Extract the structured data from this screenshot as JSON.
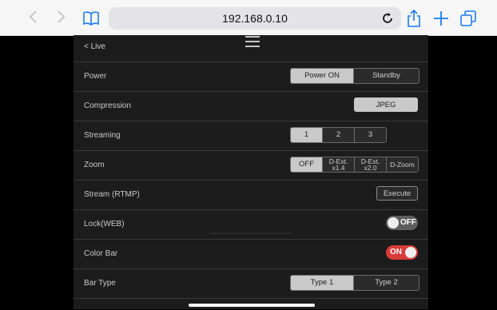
{
  "browser": {
    "url": "192.168.0.10",
    "icons": [
      "chevron-left-icon",
      "chevron-right-icon",
      "bookmarks-icon",
      "reload-icon",
      "share-icon",
      "plus-icon",
      "tabs-icon"
    ]
  },
  "page": {
    "back_label": "< Live",
    "menu_icon": "hamburger-menu-icon"
  },
  "settings": {
    "power": {
      "label": "Power",
      "options": [
        "Power ON",
        "Standby"
      ],
      "selected": "Power ON"
    },
    "compression": {
      "label": "Compression",
      "button": "JPEG"
    },
    "streaming": {
      "label": "Streaming",
      "options": [
        "1",
        "2",
        "3"
      ],
      "selected": "1"
    },
    "zoom": {
      "label": "Zoom",
      "options": [
        {
          "line1": "OFF",
          "line2": ""
        },
        {
          "line1": "D-Ext.",
          "line2": "x1.4"
        },
        {
          "line1": "D-Ext.",
          "line2": "x2.0"
        },
        {
          "line1": "D-Zoom",
          "line2": ""
        }
      ],
      "selected": "OFF"
    },
    "stream_rtmp": {
      "label": "Stream (RTMP)",
      "button": "Execute"
    },
    "lock_web": {
      "label": "Lock(WEB)",
      "state": "OFF"
    },
    "color_bar": {
      "label": "Color Bar",
      "state": "ON"
    },
    "bar_type": {
      "label": "Bar Type",
      "options": [
        "Type 1",
        "Type 2"
      ],
      "selected": "Type 1"
    }
  },
  "colors": {
    "toggle_on": "#d93a3a",
    "toggle_off": "#5e5e5e",
    "selected_segment": "#c9c9c9"
  }
}
